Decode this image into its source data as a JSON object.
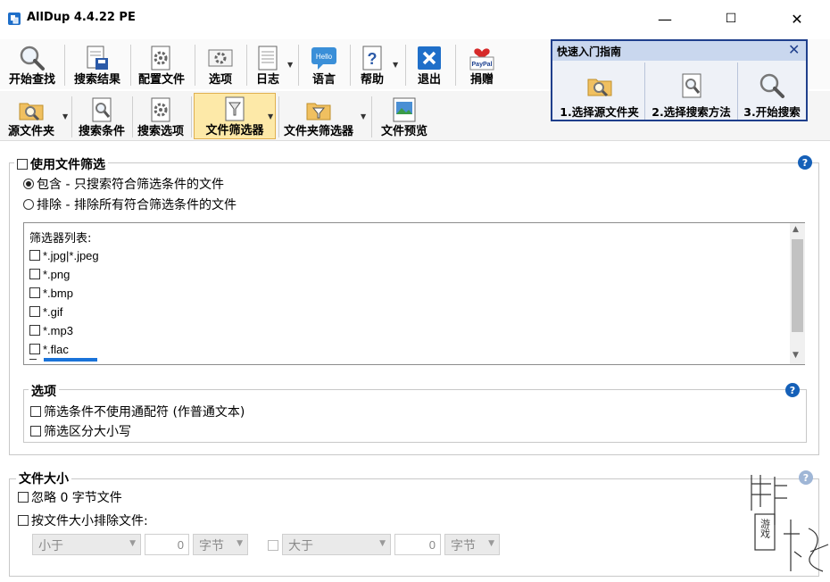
{
  "window": {
    "title": "AllDup 4.4.22 PE",
    "minimize": "—",
    "maximize": "☐",
    "close": "✕"
  },
  "toolbar1": [
    {
      "label": "开始查找",
      "icon": "magnifier-icon"
    },
    {
      "label": "搜索结果",
      "icon": "results-icon"
    },
    {
      "label": "配置文件",
      "icon": "profile-gear-icon"
    },
    {
      "label": "选项",
      "icon": "options-icon"
    },
    {
      "label": "日志",
      "icon": "log-icon"
    },
    {
      "label": "语言",
      "icon": "language-hello-icon",
      "icon_text": "Hello"
    },
    {
      "label": "帮助",
      "icon": "help-question-icon"
    },
    {
      "label": "退出",
      "icon": "exit-x-icon"
    },
    {
      "label": "捐赠",
      "icon": "paypal-heart-icon",
      "icon_text": "PayPal"
    }
  ],
  "toolbar2": [
    {
      "label": "源文件夹",
      "icon": "source-folder-icon"
    },
    {
      "label": "搜索条件",
      "icon": "search-criteria-icon"
    },
    {
      "label": "搜索选项",
      "icon": "search-options-icon"
    },
    {
      "label": "文件筛选器",
      "icon": "file-filter-icon",
      "active": true
    },
    {
      "label": "文件夹筛选器",
      "icon": "folder-filter-icon"
    },
    {
      "label": "文件预览",
      "icon": "file-preview-icon"
    }
  ],
  "guide": {
    "title": "快速入门指南",
    "close": "✕",
    "steps": [
      "1.选择源文件夹",
      "2.选择搜索方法",
      "3.开始搜索"
    ]
  },
  "file_filter": {
    "enable_label": "使用文件筛选",
    "help": "?",
    "include_label": "包含 - 只搜索符合筛选条件的文件",
    "exclude_label": "排除 - 排除所有符合筛选条件的文件",
    "mode": "include",
    "list_header": "筛选器列表:",
    "items": [
      "*.jpg|*.jpeg",
      "*.png",
      "*.bmp",
      "*.gif",
      "*.mp3",
      "*.flac"
    ],
    "options": {
      "title": "选项",
      "no_wildcard": "筛选条件不使用通配符 (作普通文本)",
      "case_sensitive": "筛选区分大小写"
    }
  },
  "file_size": {
    "title": "文件大小",
    "ignore_zero": "忽略 0 字节文件",
    "exclude_by_size": "按文件大小排除文件:",
    "less_than": "小于",
    "less_value": "0",
    "unit1": "字节",
    "greater_than": "大于",
    "greater_value": "0",
    "unit2": "字节"
  },
  "watermark": {
    "text": "游戏"
  },
  "colors": {
    "accent_blue": "#1560b8",
    "guide_border": "#1f3f8c",
    "active_tab": "#fde9a8"
  }
}
